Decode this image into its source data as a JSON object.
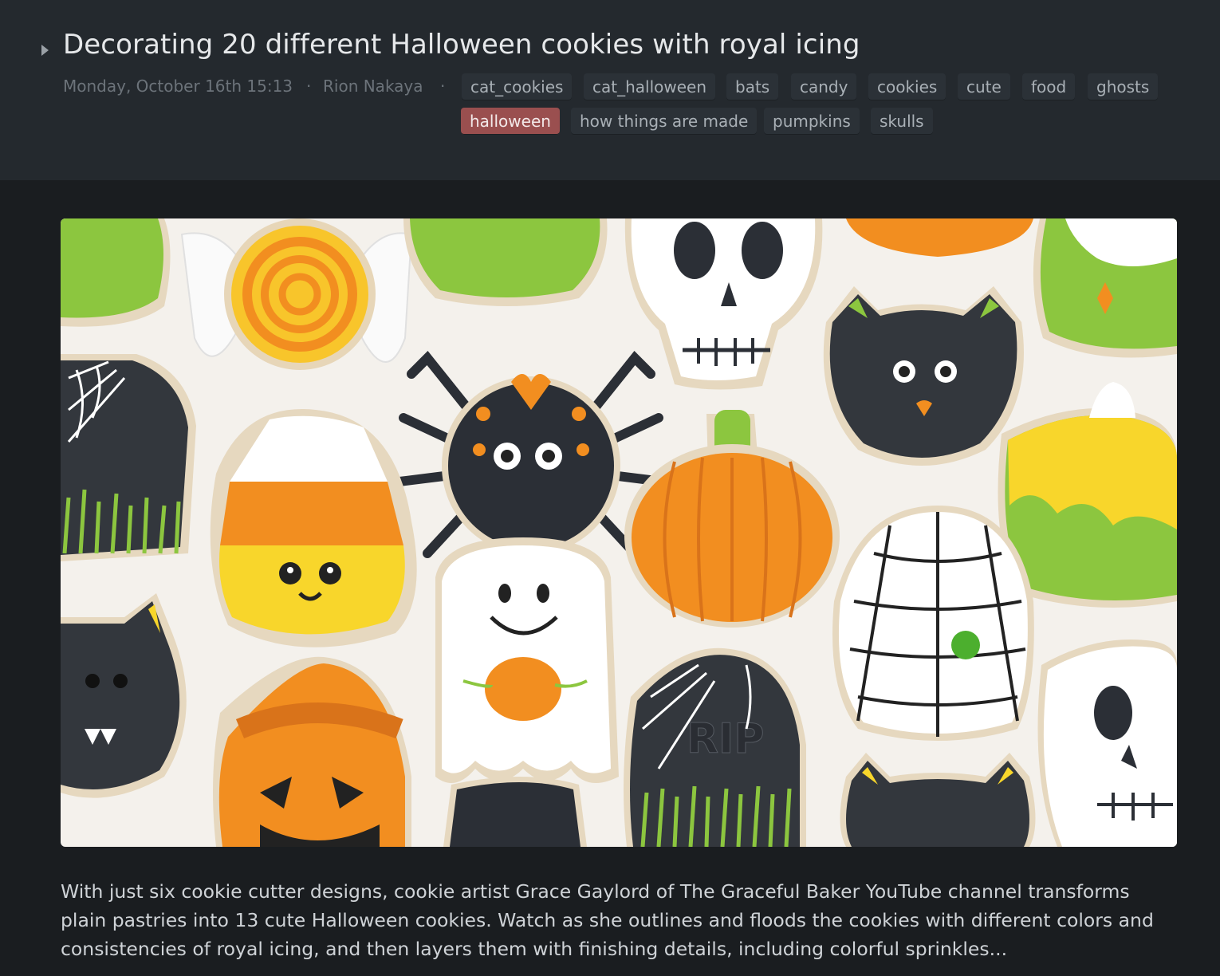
{
  "post": {
    "title": "Decorating 20 different Halloween cookies with royal icing",
    "date": "Monday, October 16th 15:13",
    "author": "Rion Nakaya",
    "separator": "·",
    "tags": [
      {
        "label": "cat_cookies",
        "active": false
      },
      {
        "label": "cat_halloween",
        "active": false
      },
      {
        "label": "bats",
        "active": false
      },
      {
        "label": "candy",
        "active": false
      },
      {
        "label": "cookies",
        "active": false
      },
      {
        "label": "cute",
        "active": false
      },
      {
        "label": "food",
        "active": false
      },
      {
        "label": "ghosts",
        "active": false
      },
      {
        "label": "halloween",
        "active": true
      },
      {
        "label": "how things are made",
        "active": false
      },
      {
        "label": "pumpkins",
        "active": false
      },
      {
        "label": "skulls",
        "active": false
      }
    ],
    "description": "With just six cookie cutter designs, cookie artist Grace Gaylord of The Graceful Baker YouTube channel transforms plain pastries into 13 cute Halloween cookies. Watch as she outlines and floods the cookies with different colors and consistencies of royal icing, and then layers them with finishing details, including colorful sprinkles...",
    "image_text": "RIP"
  },
  "colors": {
    "header_bg": "#24292e",
    "page_bg": "#1a1d20",
    "tag_bg": "#2b3137",
    "tag_active_bg": "#9a4f4f"
  }
}
